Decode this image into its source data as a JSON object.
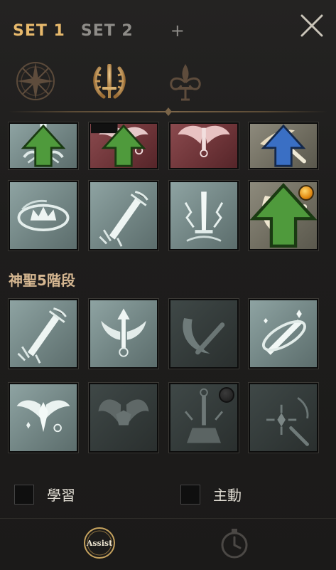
{
  "tabs": {
    "set1_label": "SET 1",
    "set2_label": "SET 2",
    "add_label": "+"
  },
  "categories": [
    {
      "icon": "compass-star-icon"
    },
    {
      "icon": "laurel-sword-icon",
      "selected": true
    },
    {
      "icon": "fleur-ornament-icon"
    }
  ],
  "section": {
    "label": "神聖5階段"
  },
  "skill_icons_row1": [
    "holy-sword-impact-icon",
    "winged-cross-icon",
    "winged-cross-icon",
    "winged-dash-icon"
  ],
  "skill_icons_row2": [
    "holy-crown-whirl-icon",
    "sword-shatter-icon",
    "lightning-sword-icon",
    "crescent-slash-icon"
  ],
  "skill_icons_row3": [
    "sword-shatter-icon",
    "winged-arrow-icon",
    "dark-slash-icon",
    "crossed-sword-icon"
  ],
  "skill_icons_row4": [
    "winged-crest-icon",
    "dark-wings-icon",
    "sword-pedestal-icon",
    "star-burst-icon"
  ],
  "toggles": {
    "learn_label": "學習",
    "active_label": "主動"
  },
  "footer": {
    "assist_label": "Assist"
  },
  "colors": {
    "accent": "#e7b96c",
    "upgrade_green": "#4f9a3c",
    "upgrade_blue": "#3a6fc4"
  }
}
